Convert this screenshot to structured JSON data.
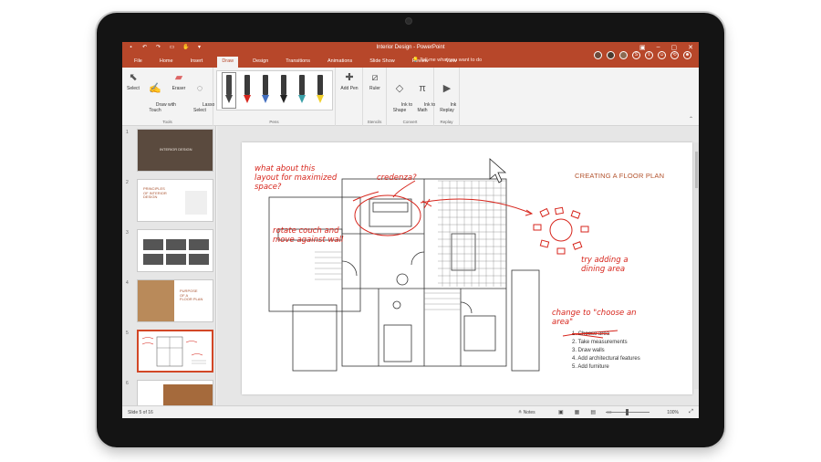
{
  "window": {
    "title": "Interior Design - PowerPoint",
    "tell_me": "Tell me what you want to do"
  },
  "colors": {
    "accent": "#b7472a",
    "ink": "#d7261d",
    "slide_title": "#b3532e"
  },
  "tabs": [
    "File",
    "Home",
    "Insert",
    "Draw",
    "Design",
    "Transitions",
    "Animations",
    "Slide Show",
    "Review",
    "View"
  ],
  "active_tab": "Draw",
  "ribbon": {
    "tools": {
      "label": "Tools",
      "select": "Select",
      "draw_with_touch": "Draw with\nTouch",
      "eraser": "Eraser",
      "lasso_select": "Lasso\nSelect"
    },
    "pens": {
      "label": "Pens"
    },
    "add_pen": "Add Pen",
    "stencils": {
      "label": "Stencils",
      "ruler": "Ruler"
    },
    "convert": {
      "label": "Convert",
      "ink_to_shape": "Ink to\nShape",
      "ink_to_math": "Ink to\nMath"
    },
    "replay": {
      "label": "Replay",
      "ink_replay": "Ink\nReplay"
    }
  },
  "thumbnails": [
    {
      "num": "1",
      "text": "INTERIOR DESIGN"
    },
    {
      "num": "2",
      "text": "PRINCIPLES\nOF INTERIOR\nDESIGN"
    },
    {
      "num": "3",
      "text": ""
    },
    {
      "num": "4",
      "text": "PURPOSE\nOF A\nFLOOR PLAN"
    },
    {
      "num": "5",
      "text": ""
    },
    {
      "num": "6",
      "text": ""
    }
  ],
  "slide": {
    "title": "CREATING A FLOOR PLAN",
    "steps": [
      "1. Choose area",
      "2. Take measurements",
      "3. Draw walls",
      "4. Add architectural features",
      "5. Add furniture"
    ],
    "ink": {
      "note1": "what about this\nlayout for maximized\nspace?",
      "note2": "credenza?",
      "note3": "rotate couch and\nmove against wall",
      "note4": "try adding a\ndining area",
      "note5": "change to \"choose an\narea\""
    }
  },
  "status": {
    "slide_counter": "Slide 5 of 16",
    "notes": "Notes",
    "zoom": "100%"
  }
}
